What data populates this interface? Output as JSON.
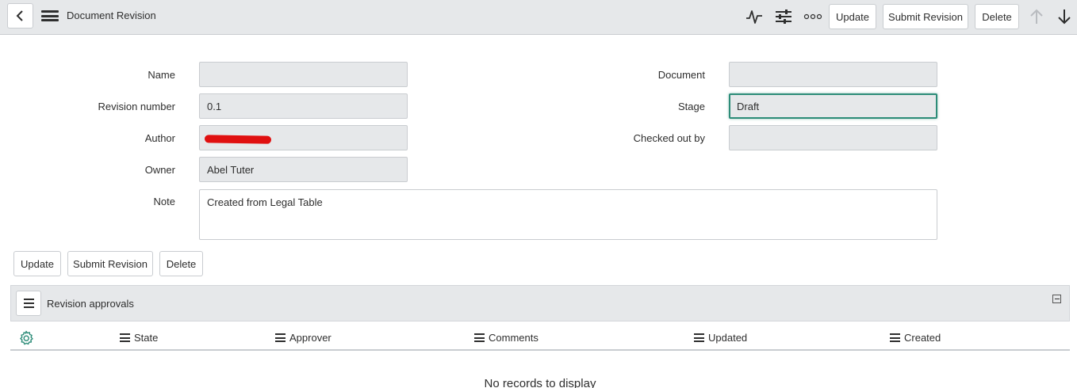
{
  "header": {
    "title": "Document Revision",
    "icons": [
      "back-icon",
      "hamburger-menu-icon",
      "activity-icon",
      "personalize-sliders-icon",
      "more-options-icon",
      "previous-record-icon",
      "next-record-icon"
    ],
    "buttons": {
      "update": "Update",
      "submit_revision": "Submit Revision",
      "delete": "Delete"
    }
  },
  "form": {
    "name": {
      "label": "Name",
      "value": ""
    },
    "revision_number": {
      "label": "Revision number",
      "value": "0.1"
    },
    "author": {
      "label": "Author",
      "value": ""
    },
    "owner": {
      "label": "Owner",
      "value": "Abel Tuter"
    },
    "note": {
      "label": "Note",
      "value": "Created from Legal Table"
    },
    "document": {
      "label": "Document",
      "value": ""
    },
    "stage": {
      "label": "Stage",
      "value": "Draft"
    },
    "checked_out_by": {
      "label": "Checked out by",
      "value": ""
    }
  },
  "form_buttons": {
    "update": "Update",
    "submit_revision": "Submit Revision",
    "delete": "Delete"
  },
  "related_list": {
    "title": "Revision approvals",
    "columns": [
      "State",
      "Approver",
      "Comments",
      "Updated",
      "Created"
    ],
    "empty_message": "No records to display"
  },
  "colors": {
    "header_bg": "#e6e8ea",
    "focus_border": "#2c8c78",
    "gear": "#2c8c78",
    "redaction": "#e01010"
  }
}
